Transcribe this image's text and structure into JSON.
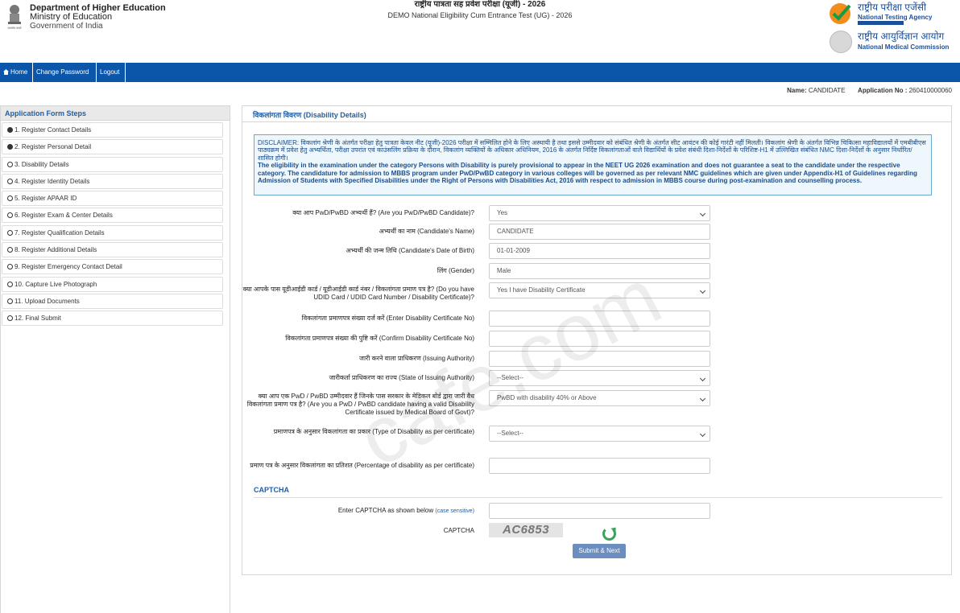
{
  "header": {
    "dept_line1": "Department of Higher Education",
    "dept_line2": "Ministry of Education",
    "dept_line3": "Government of India",
    "exam_title_hindi": "राष्ट्रीय पात्रता सह प्रवेश परीक्षा (यूजी) - 2026",
    "exam_title_en": "DEMO National Eligibility Cum Entrance Test (UG) - 2026",
    "nta_hindi": "राष्ट्रीय परीक्षा एजेंसी",
    "nta_en": "National Testing Agency",
    "nmc_hindi": "राष्ट्रीय आयुर्विज्ञान आयोग",
    "nmc_en": "National Medical Commission"
  },
  "nav": {
    "home": "Home",
    "change_password": "Change Password",
    "logout": "Logout"
  },
  "candidate": {
    "name_label": "Name:",
    "name_value": "CANDIDATE",
    "app_label": "Application No :",
    "app_value": "260410000060"
  },
  "sidebar": {
    "title": "Application Form Steps",
    "items": [
      {
        "label": "1. Register Contact Details",
        "done": true
      },
      {
        "label": "2. Register Personal Detail",
        "done": true
      },
      {
        "label": "3. Disability Details",
        "done": false
      },
      {
        "label": "4. Register Identity Details",
        "done": false
      },
      {
        "label": "5. Register APAAR ID",
        "done": false
      },
      {
        "label": "6. Register Exam & Center Details",
        "done": false
      },
      {
        "label": "7. Register Qualification Details",
        "done": false
      },
      {
        "label": "8. Register Additional Details",
        "done": false
      },
      {
        "label": "9. Register Emergency Contact Detail",
        "done": false
      },
      {
        "label": "10. Capture Live Photograph",
        "done": false
      },
      {
        "label": "11. Upload Documents",
        "done": false
      },
      {
        "label": "12. Final Submit",
        "done": false
      }
    ]
  },
  "panel": {
    "title": "विकलांगता विवरण (Disability Details)",
    "disclaimer_hi": "DISCLAIMER: विकलांग श्रेणी के अंतर्गत परीक्षा हेतु पात्रता केवल नीट (यूजी)-2026 परीक्षा में सम्मिलित होने के लिए अस्थायी है तथा इससे उम्मीदवार को संबंधित श्रेणी के अंतर्गत सीट आवंटन की कोई गारंटी नहीं मिलती। विकलांग श्रेणी के अंतर्गत विभिन्न चिकित्सा महाविद्यालयों में एमबीबीएस पाठ्यक्रम में प्रवेश हेतु अभ्यर्थिता, परीक्षा उपरांत एवं काउंसलिंग प्रक्रिया के दौरान, विकलांग व्यक्तियों के अधिकार अधिनियम, 2016 के अंतर्गत निर्दिष्ट विकलांगताओं वाले विद्यार्थियों के प्रवेश संबंधी दिशा-निर्देशों के परिशिष्ट-H1 में उल्लिखित संबंधित NMC दिशा-निर्देशों के अनुसार निर्धारित/शासित होगी।",
    "disclaimer_en": "The eligibility in the examination under the category Persons with Disability is purely provisional to appear in the NEET UG 2026 examination and does not guarantee a seat to the candidate under the respective category. The candidature for admission to MBBS program under PwD/PwBD category in various colleges will be governed as per relevant NMC guidelines which are given under Appendix-H1 of Guidelines regarding Admission of Students with Specified Disabilities under the Right of Persons with Disabilities Act, 2016 with respect to admission in MBBS course during post-examination and counselling process."
  },
  "form": {
    "pwd_label": "क्या आप PwD/PwBD अभ्यर्थी हैं? (Are you PwD/PwBD Candidate)?",
    "pwd_value": "Yes",
    "name_label": "अभ्यर्थी का नाम (Candidate's Name)",
    "name_value": "CANDIDATE",
    "dob_label": "अभ्यर्थी की जन्म तिथि (Candidate's Date of Birth)",
    "dob_value": "01-01-2009",
    "gender_label": "लिंग (Gender)",
    "gender_value": "Male",
    "udid_label": "क्या आपके पास यूडीआईडी कार्ड / यूडीआईडी कार्ड नंबर / विकलांगता प्रमाण पत्र है? (Do you have UDID Card / UDID Card Number / Disability Certificate)?",
    "udid_value": "Yes I have Disability Certificate",
    "cert_no_label": "विकलांगता प्रमाणपत्र संख्या दर्ज करें (Enter Disability Certificate No)",
    "cert_no_value": "",
    "cert_confirm_label": "विकलांगता प्रमाणपत्र संख्या की पुष्टि करें (Confirm Disability Certificate No)",
    "cert_confirm_value": "",
    "authority_label": "जारी करने वाला प्राधिकरण (Issuing Authority)",
    "authority_value": "",
    "state_label": "जारीकर्ता प्राधिकरण का राज्य (State of Issuing Authority)",
    "state_value": "--Select--",
    "medboard_label": "क्या आप एक PwD / PwBD उम्मीदवार हैं जिनके पास सरकार के मेडिकल बोर्ड द्वारा जारी वैध विकलांगता प्रमाण पत्र है? (Are you a PwD / PwBD candidate having a valid Disability Certificate issued by Medical Board of Govt)?",
    "medboard_value": "PwBD with disability 40% or Above",
    "type_label": "प्रमाणपत्र के अनुसार विकलांगता का प्रकार (Type of Disability as per certificate)",
    "type_value": "--Select--",
    "percent_label": "प्रमाण पत्र के अनुसार विकलांगता का प्रतिशत (Percentage of disability as per certificate)",
    "percent_value": ""
  },
  "captcha": {
    "section_title": "CAPTCHA",
    "enter_label": "Enter CAPTCHA as shown below",
    "case_note": "(case sensitive)",
    "enter_value": "",
    "captcha_label": "CAPTCHA",
    "captcha_text": "AC6853",
    "submit": "Submit & Next"
  },
  "watermark": "cafe.com"
}
